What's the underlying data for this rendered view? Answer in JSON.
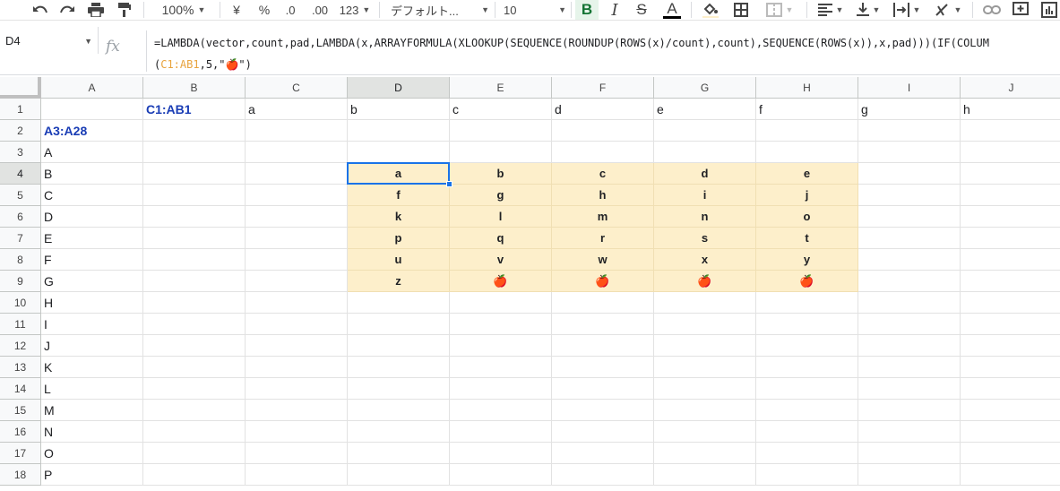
{
  "toolbar": {
    "zoom": "100%",
    "currency": "¥",
    "percent": "%",
    "dec_less": ".0",
    "dec_more": ".00",
    "format_num": "123",
    "font": "デフォルト...",
    "font_size": "10",
    "bold": "B",
    "italic": "I",
    "strike": "S",
    "text_color": "A"
  },
  "formula_bar": {
    "name_box": "D4",
    "fx": "fx",
    "line1": "=LAMBDA(vector,count,pad,LAMBDA(x,ARRAYFORMULA(XLOOKUP(SEQUENCE(ROUNDUP(ROWS(x)/count),count),SEQUENCE(ROWS(x)),x,pad)))(IF(COLUM",
    "line2_open": "(",
    "line2_ref": "C1:AB1",
    "line2_rest": ",5,\"🍎\")"
  },
  "columns": [
    "A",
    "B",
    "C",
    "D",
    "E",
    "F",
    "G",
    "H",
    "I",
    "J"
  ],
  "selected_column": "D",
  "rows": [
    "1",
    "2",
    "3",
    "4",
    "5",
    "6",
    "7",
    "8",
    "9",
    "10",
    "11",
    "12",
    "13",
    "14",
    "15",
    "16",
    "17",
    "18"
  ],
  "selected_row": "4",
  "header_row": {
    "B": "C1:AB1",
    "C": "a",
    "D": "b",
    "E": "c",
    "F": "d",
    "G": "e",
    "H": "f",
    "I": "g",
    "J": "h"
  },
  "a2_label": "A3:A28",
  "column_a_values": [
    "A",
    "B",
    "C",
    "D",
    "E",
    "F",
    "G",
    "H",
    "I",
    "J",
    "K",
    "L",
    "M",
    "N",
    "O",
    "P"
  ],
  "result_grid": [
    [
      "a",
      "b",
      "c",
      "d",
      "e"
    ],
    [
      "f",
      "g",
      "h",
      "i",
      "j"
    ],
    [
      "k",
      "l",
      "m",
      "n",
      "o"
    ],
    [
      "p",
      "q",
      "r",
      "s",
      "t"
    ],
    [
      "u",
      "v",
      "w",
      "x",
      "y"
    ],
    [
      "z",
      "🍎",
      "🍎",
      "🍎",
      "🍎"
    ]
  ],
  "colors": {
    "highlight_fill": "#fdefcb",
    "selection": "#1a73e8",
    "range_label": "#1a3db5",
    "formula_ref": "#e8a33d"
  }
}
